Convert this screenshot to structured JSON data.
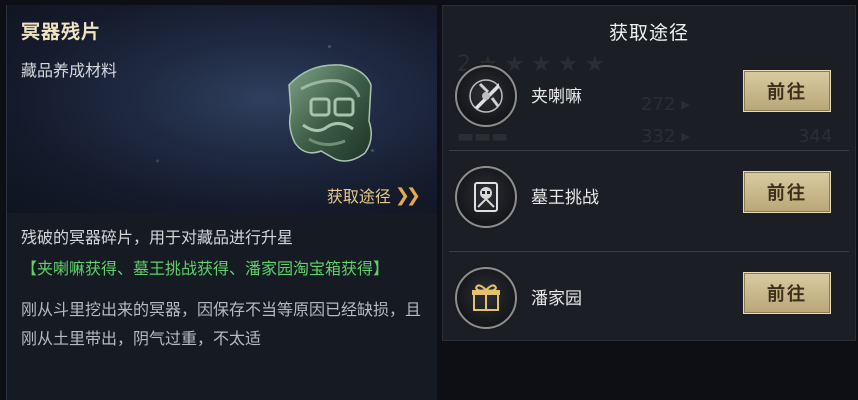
{
  "item": {
    "name": "冥器残片",
    "category": "藏品养成材料",
    "source_link": "获取途径",
    "description": "残破的冥器碎片，用于对藏品进行升星",
    "sources_line": "【夹喇嘛获得、墓王挑战获得、潘家园淘宝箱获得】",
    "lore": "刚从斗里挖出来的冥器，因保存不当等原因已经缺损，且刚从土里带出，阴气过重，不太适"
  },
  "acquire": {
    "title": "获取途径",
    "sources": [
      {
        "label": "夹喇嘛",
        "button": "前往",
        "icon": "crossed-swords-icon"
      },
      {
        "label": "墓王挑战",
        "button": "前往",
        "icon": "tomb-king-icon"
      },
      {
        "label": "潘家园",
        "button": "前往",
        "icon": "treasure-box-icon"
      }
    ]
  },
  "colors": {
    "title_gold": "#f1e4c3",
    "green_text": "#5fd06a",
    "button_gold": "#cbbb8c",
    "link_gold": "#e6c98a"
  }
}
